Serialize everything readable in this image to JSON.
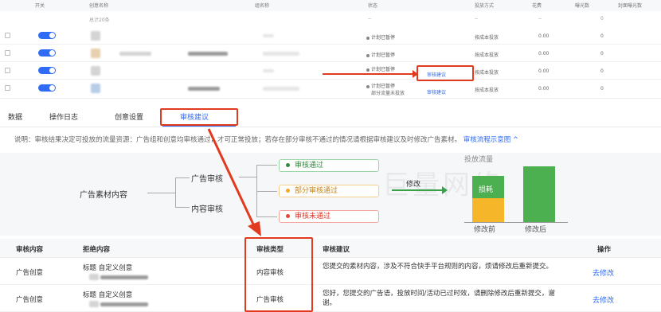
{
  "top_table": {
    "headers": [
      "开关",
      "创意名称",
      "组名称",
      "状态",
      "投放方式",
      "花费",
      "曝光数",
      "封面曝光数"
    ],
    "summary_label": "总计20条",
    "rows": [
      {
        "status": "--",
        "method": "--",
        "cost": "--",
        "exposure": "0"
      },
      {
        "status": "计划已暂停",
        "method": "按成本投放",
        "cost": "0.00",
        "exposure": "0"
      },
      {
        "status": "计划已暂停",
        "method": "按成本投放",
        "cost": "0.00",
        "exposure": "0"
      },
      {
        "status": "计划已暂停",
        "link": "审核建议",
        "method": "按成本投放",
        "cost": "0.00",
        "exposure": "0"
      },
      {
        "status": "计划已暂停",
        "status2": "部分流量未投放",
        "link": "审核建议",
        "method": "按成本投放",
        "cost": "0.00",
        "exposure": "0"
      }
    ]
  },
  "tabs": [
    {
      "label": "数据"
    },
    {
      "label": "操作日志"
    },
    {
      "label": "创意设置"
    },
    {
      "label": "审核建议"
    }
  ],
  "explain": {
    "text": "说明：审核结果决定可投放的流量资源：广告组和创意均审核通过，才可正常投放；若存在部分审核不通过的情况请根据审核建议及时修改广告素材。",
    "link": "审核流程示意图 ^"
  },
  "diagram": {
    "root": "广告素材内容",
    "branch_ad": "广告审核",
    "branch_content": "内容审核",
    "pass": "审核通过",
    "partial": "部分审核通过",
    "fail": "审核未通过",
    "modify": "修改",
    "watermark": "巨量网络"
  },
  "chart_data": {
    "type": "bar",
    "title": "投放流量",
    "categories": [
      "修改前",
      "修改后"
    ],
    "series": [
      {
        "name": "流量",
        "values": [
          0.43,
          1.0
        ]
      }
    ],
    "annotations": [
      "损耗"
    ],
    "colors": {
      "before_top": "#4caf50",
      "before_bottom": "#f5b62a",
      "after": "#4caf50"
    }
  },
  "bottom_table": {
    "headers": [
      "审核内容",
      "拒绝内容",
      "审核类型",
      "审核建议",
      "操作"
    ],
    "rows": [
      {
        "content": "广告创意",
        "reject": "标题 自定义创意",
        "type": "内容审核",
        "suggestion": "您提交的素材内容，涉及不符合快手平台规则的内容，烦请修改后重新提交。",
        "action": "去修改"
      },
      {
        "content": "广告创意",
        "reject": "标题 自定义创意",
        "type": "广告审核",
        "suggestion": "您好，您提交的广告语，投放时间/活动已过时效，请删除修改后重新提交，谢谢。",
        "action": "去修改"
      }
    ]
  },
  "colors": {
    "accent": "#2f6bf5",
    "highlight": "#e23a1e",
    "pass": "#2e8b3e",
    "partial": "#f5a623",
    "fail": "#e6453a"
  }
}
